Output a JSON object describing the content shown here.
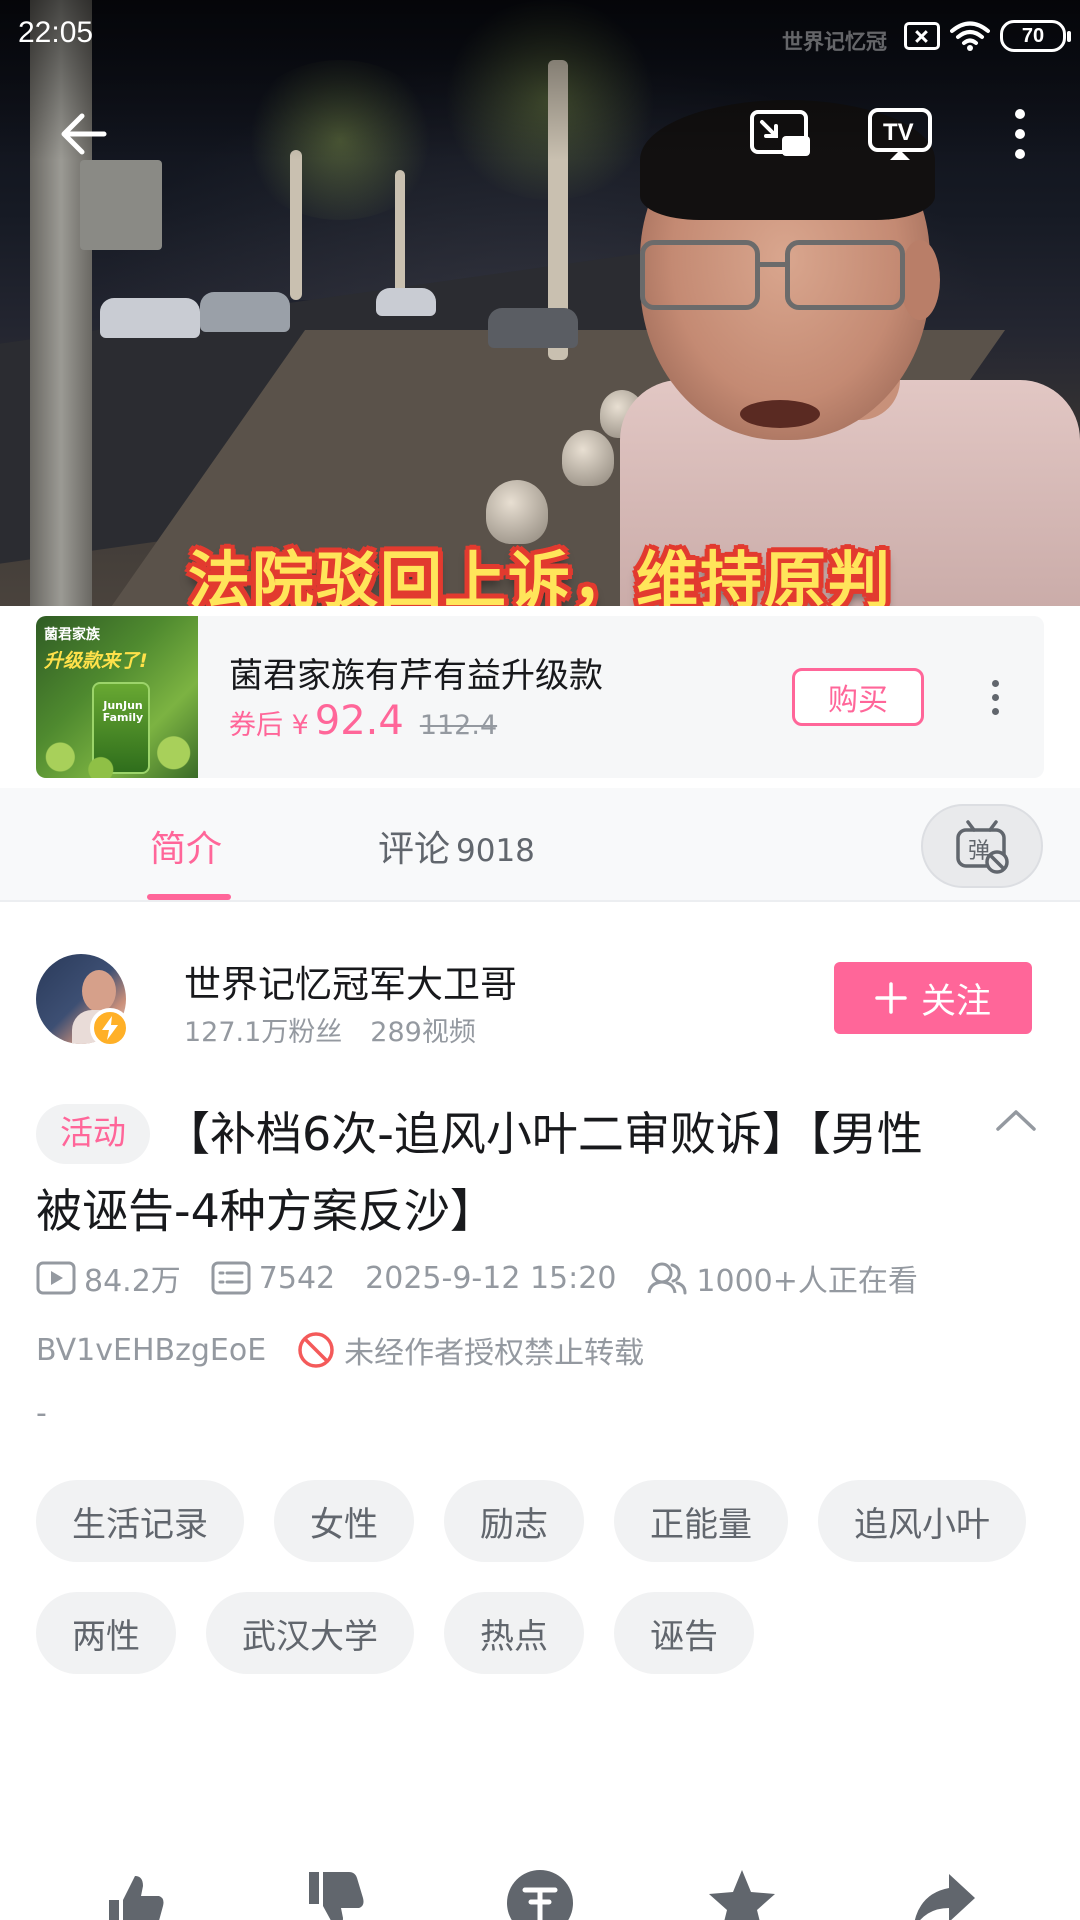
{
  "status_bar": {
    "time": "22:05",
    "battery": "70"
  },
  "video": {
    "subtitle": "法院驳回上诉，维持原判",
    "watermark": "世界记忆冠"
  },
  "ad": {
    "thumb_brand": "菌君家族",
    "thumb_promo": "升级款来了!",
    "thumb_bottle": "JunJun Family",
    "title": "菌君家族有芹有益升级款",
    "price_prefix": "券后 ¥",
    "price": "92.4",
    "original_price": "112.4",
    "buy_label": "购买"
  },
  "tabs": {
    "intro_label": "简介",
    "comments_label": "评论",
    "comments_count": "9018"
  },
  "uploader": {
    "name": "世界记忆冠军大卫哥",
    "fans": "127.1万粉丝",
    "videos": "289视频",
    "follow_label": "关注"
  },
  "video_info": {
    "activity_tag": "活动",
    "title": "【补档6次-追风小叶二审败诉】【男性被诬告-4种方案反沙】",
    "views": "84.2万",
    "danmaku_count": "7542",
    "publish_time": "2025-9-12 15:20",
    "watching": "1000+人正在看",
    "bvid": "BV1vEHBzgEoE",
    "copyright": "未经作者授权禁止转载",
    "description": "-"
  },
  "tags": [
    "生活记录",
    "女性",
    "励志",
    "正能量",
    "追风小叶",
    "两性",
    "武汉大学",
    "热点",
    "诬告"
  ],
  "colors": {
    "accent": "#ff6699",
    "subtitle_fill": "#ffe55a",
    "subtitle_stroke": "#e23a2f",
    "muted_text": "#9499a0"
  },
  "icons": [
    "back-arrow-icon",
    "cast-icon",
    "tv-icon",
    "more-vertical-icon",
    "danmaku-toggle-icon",
    "play-count-icon",
    "danmaku-count-icon",
    "viewers-icon",
    "no-repost-icon",
    "like-icon",
    "dislike-icon",
    "coin-icon",
    "favorite-icon",
    "share-icon"
  ]
}
